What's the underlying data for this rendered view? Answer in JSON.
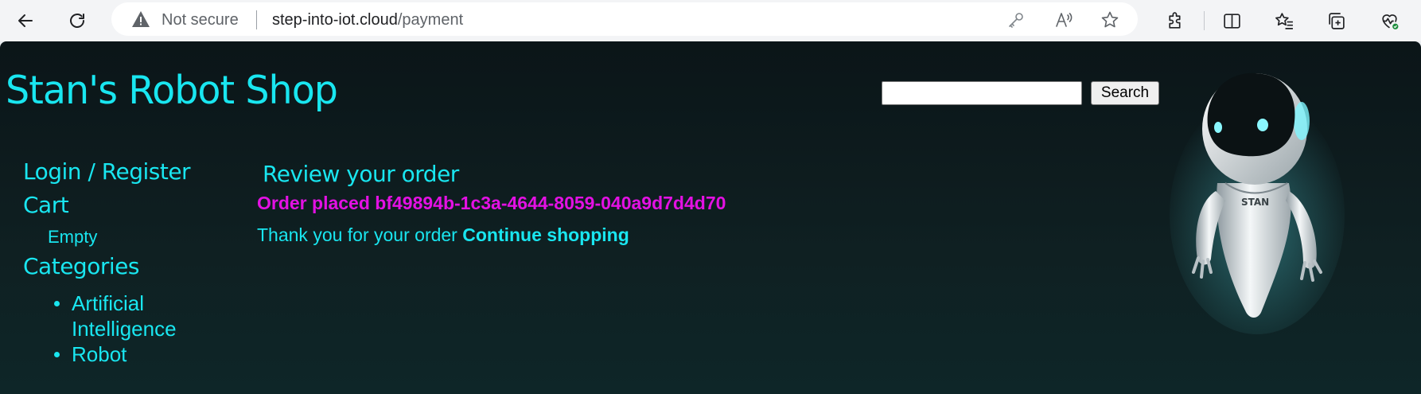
{
  "browser": {
    "security_label": "Not secure",
    "url_domain": "step-into-iot.cloud",
    "url_path": "/payment",
    "nav_icons": [
      "back-arrow-icon",
      "refresh-icon"
    ],
    "address_icons": [
      "warning-icon",
      "key-icon",
      "read-aloud-icon",
      "star-icon"
    ],
    "toolbar_icons": [
      "extensions-icon",
      "split-screen-icon",
      "favorites-icon",
      "collections-icon",
      "browser-essentials-icon"
    ]
  },
  "site": {
    "title": "Stan's Robot Shop",
    "search_placeholder": "",
    "search_button": "Search",
    "robot_badge": "STAN"
  },
  "sidebar": {
    "login_link": "Login / Register",
    "cart_heading": "Cart",
    "cart_status": "Empty",
    "categories_heading": "Categories",
    "categories": [
      "Artificial Intelligence",
      "Robot"
    ]
  },
  "main": {
    "heading": "Review your order",
    "order_placed": "Order placed bf49894b-1c3a-4644-8059-040a9d7d4d70",
    "thanks_text": "Thank you for your order ",
    "continue_link": "Continue shopping"
  },
  "colors": {
    "accent": "#19e6f0",
    "order_highlight": "#e311e3",
    "page_background": "#0e1d20"
  }
}
